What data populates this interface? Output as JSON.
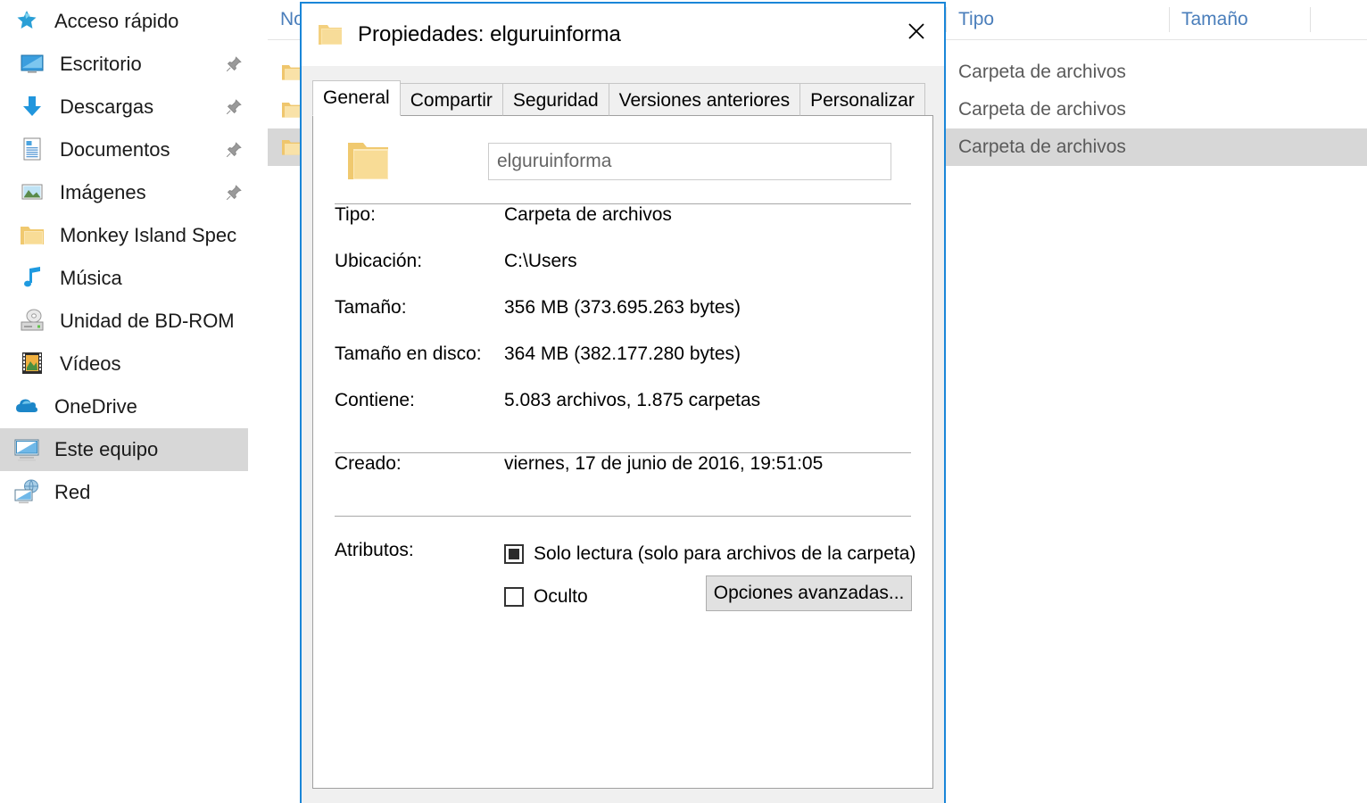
{
  "explorer": {
    "nav_pane": {
      "items": [
        {
          "label": "Acceso rápido",
          "icon": "star-icon",
          "level": "root",
          "pinned": false,
          "selected": false
        },
        {
          "label": "Escritorio",
          "icon": "desktop-icon",
          "level": "child",
          "pinned": true,
          "selected": false
        },
        {
          "label": "Descargas",
          "icon": "download-arrow-icon",
          "level": "child",
          "pinned": true,
          "selected": false
        },
        {
          "label": "Documentos",
          "icon": "document-icon",
          "level": "child",
          "pinned": true,
          "selected": false
        },
        {
          "label": "Imágenes",
          "icon": "picture-icon",
          "level": "child",
          "pinned": true,
          "selected": false
        },
        {
          "label": "Monkey Island Spec",
          "icon": "folder-icon",
          "level": "child",
          "pinned": false,
          "selected": false
        },
        {
          "label": "Música",
          "icon": "music-note-icon",
          "level": "child",
          "pinned": false,
          "selected": false
        },
        {
          "label": "Unidad de BD-ROM",
          "icon": "optical-drive-icon",
          "level": "child",
          "pinned": false,
          "selected": false
        },
        {
          "label": "Vídeos",
          "icon": "video-film-icon",
          "level": "child",
          "pinned": false,
          "selected": false
        },
        {
          "label": "OneDrive",
          "icon": "cloud-icon",
          "level": "root",
          "pinned": false,
          "selected": false
        },
        {
          "label": "Este equipo",
          "icon": "computer-icon",
          "level": "root",
          "pinned": false,
          "selected": true
        },
        {
          "label": "Red",
          "icon": "network-icon",
          "level": "root",
          "pinned": false,
          "selected": false
        }
      ]
    },
    "file_list": {
      "columns": [
        {
          "label": "Nombre",
          "key": "name"
        },
        {
          "label": "Tipo",
          "key": "type"
        },
        {
          "label": "Tamaño",
          "key": "size"
        }
      ],
      "rows": [
        {
          "type": "Carpeta de archivos",
          "size": "",
          "selected": false
        },
        {
          "type": "Carpeta de archivos",
          "size": "",
          "selected": false
        },
        {
          "type": "Carpeta de archivos",
          "size": "",
          "selected": true
        }
      ]
    }
  },
  "dialog": {
    "title": "Propiedades: elguruinforma",
    "title_icon": "folder-icon",
    "close_label": "✕",
    "tabs": [
      {
        "label": "General",
        "active": true
      },
      {
        "label": "Compartir",
        "active": false
      },
      {
        "label": "Seguridad",
        "active": false
      },
      {
        "label": "Versiones anteriores",
        "active": false
      },
      {
        "label": "Personalizar",
        "active": false
      }
    ],
    "general": {
      "folder_icon": "folder-icon",
      "name_value": "elguruinforma",
      "properties": [
        {
          "label": "Tipo:",
          "value": "Carpeta de archivos"
        },
        {
          "label": "Ubicación:",
          "value": "C:\\Users"
        },
        {
          "label": "Tamaño:",
          "value": "356 MB (373.695.263 bytes)"
        },
        {
          "label": "Tamaño en disco:",
          "value": "364 MB (382.177.280 bytes)"
        },
        {
          "label": "Contiene:",
          "value": "5.083 archivos, 1.875 carpetas"
        }
      ],
      "created": {
        "label": "Creado:",
        "value": "viernes, 17 de junio de 2016, 19:51:05"
      },
      "attributes": {
        "label": "Atributos:",
        "readonly": {
          "label": "Solo lectura (solo para archivos de la carpeta)",
          "state": "indeterminate"
        },
        "hidden": {
          "label": "Oculto",
          "state": "unchecked"
        },
        "advanced_button": "Opciones avanzadas..."
      }
    }
  },
  "colors": {
    "dialog_border": "#1a86d8",
    "selection": "#d7d7d7",
    "folder_yellow": "#f6d68a",
    "accent_blue": "#0078d7",
    "column_header_text": "#4a7ebb"
  }
}
